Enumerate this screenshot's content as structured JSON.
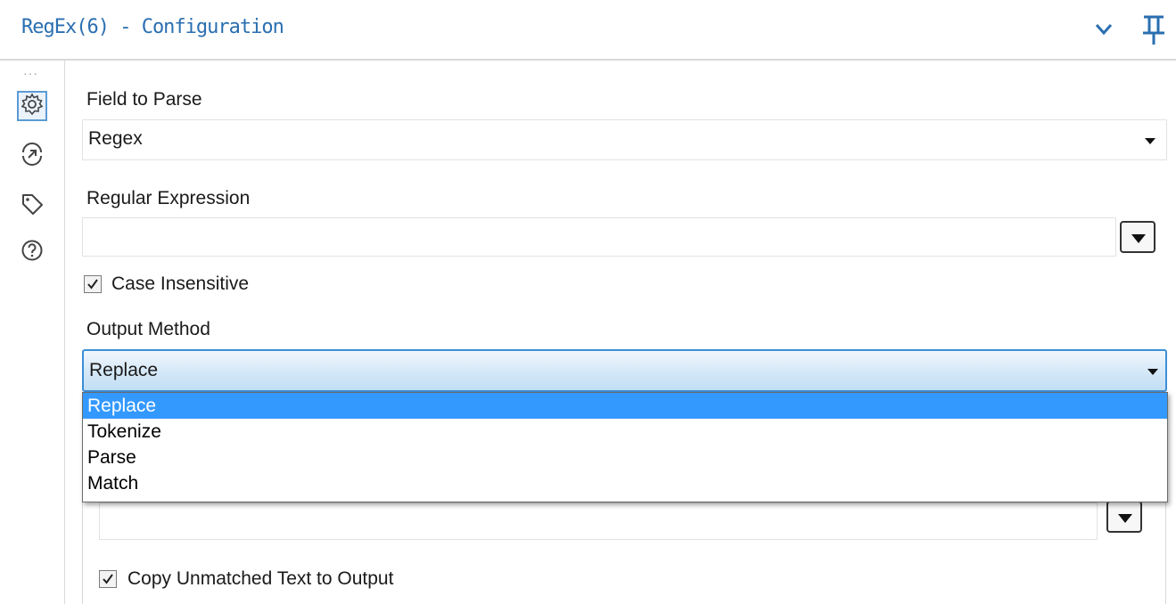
{
  "header": {
    "title": "RegEx(6) - Configuration",
    "collapse_icon": "chevron-down-icon",
    "pin_icon": "pin-icon"
  },
  "sidebar": {
    "items": [
      {
        "name": "configuration",
        "icon": "gear-icon",
        "active": true
      },
      {
        "name": "connection",
        "icon": "arrow-circle-icon",
        "active": false
      },
      {
        "name": "annotation",
        "icon": "tag-icon",
        "active": false
      },
      {
        "name": "help",
        "icon": "help-icon",
        "active": false
      }
    ]
  },
  "form": {
    "field_to_parse": {
      "label": "Field to Parse",
      "value": "Regex"
    },
    "regular_expression": {
      "label": "Regular Expression",
      "value": ""
    },
    "case_insensitive": {
      "label": "Case Insensitive",
      "checked": true
    },
    "output_method": {
      "label": "Output Method",
      "value": "Replace",
      "options": [
        "Replace",
        "Tokenize",
        "Parse",
        "Match"
      ],
      "selected_index": 0
    },
    "replacement": {
      "value": ""
    },
    "copy_unmatched": {
      "label": "Copy Unmatched Text to Output",
      "checked": true
    }
  },
  "colors": {
    "accent": "#2a6fb0",
    "selection": "#3399ff",
    "focus_border": "#3b8ed8"
  }
}
